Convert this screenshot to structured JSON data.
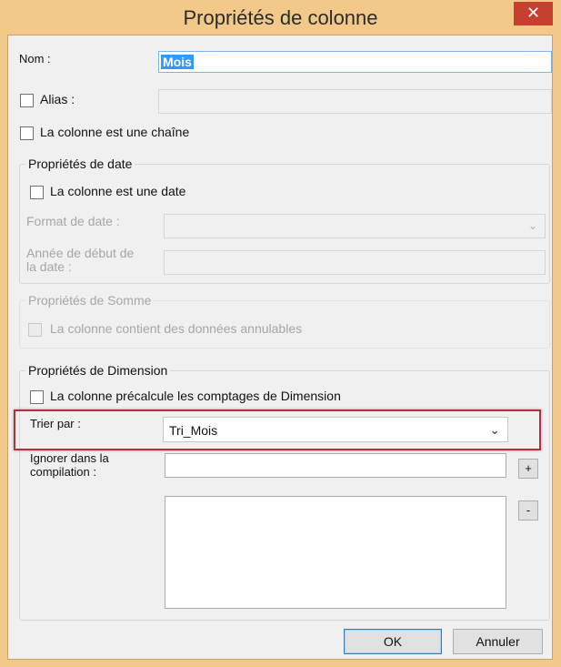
{
  "window": {
    "title": "Propriétés de colonne",
    "close_symbol": "✕"
  },
  "fields": {
    "nom_label": "Nom :",
    "nom_value": "Mois",
    "alias_label": "Alias :",
    "alias_value": "",
    "chaine_label": "La colonne est une chaîne"
  },
  "date_group": {
    "title": "Propriétés de date",
    "is_date_label": "La colonne est une date",
    "format_label": "Format de date :",
    "format_value": "",
    "annee_label": "Année de début de la date :",
    "annee_value": ""
  },
  "somme_group": {
    "title": "Propriétés de Somme",
    "annulables_label": "La colonne contient des données annulables"
  },
  "dimension_group": {
    "title": "Propriétés de Dimension",
    "precalc_label": "La colonne précalcule les comptages de Dimension",
    "trier_label": "Trier par :",
    "trier_value": "Tri_Mois",
    "ignorer_label": "Ignorer dans la compilation :",
    "ignorer_value": "",
    "add_label": "+",
    "remove_label": "-"
  },
  "buttons": {
    "ok": "OK",
    "cancel": "Annuler"
  },
  "colors": {
    "window_frame": "#f3c98a",
    "close": "#c7402f",
    "highlight": "#b3303f",
    "selection": "#3399ff"
  }
}
